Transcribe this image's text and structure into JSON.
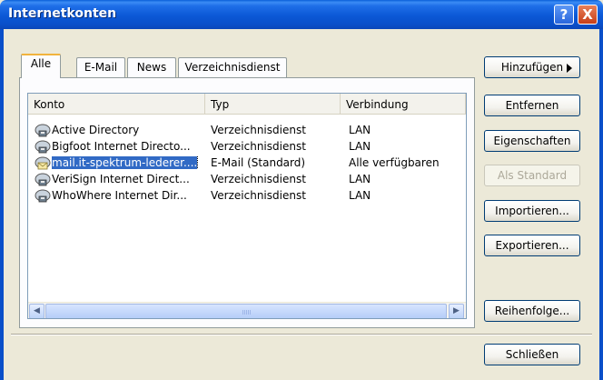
{
  "window": {
    "title": "Internetkonten"
  },
  "titlebar": {
    "help_label": "?",
    "close_label": "X"
  },
  "tabs": [
    {
      "label": "Alle",
      "active": true
    },
    {
      "label": "E-Mail",
      "active": false
    },
    {
      "label": "News",
      "active": false
    },
    {
      "label": "Verzeichnisdienst",
      "active": false
    }
  ],
  "list": {
    "columns": [
      "Konto",
      "Typ",
      "Verbindung"
    ],
    "rows": [
      {
        "konto": "Active Directory",
        "typ": "Verzeichnisdienst",
        "verbindung": "LAN",
        "icon": "directory-service-icon",
        "selected": false
      },
      {
        "konto": "Bigfoot Internet Directo...",
        "typ": "Verzeichnisdienst",
        "verbindung": "LAN",
        "icon": "directory-service-icon",
        "selected": false
      },
      {
        "konto": "mail.it-spektrum-lederer....",
        "typ": "E-Mail (Standard)",
        "verbindung": "Alle verfügbaren",
        "icon": "mail-account-icon",
        "selected": true
      },
      {
        "konto": "VeriSign Internet Direct...",
        "typ": "Verzeichnisdienst",
        "verbindung": "LAN",
        "icon": "directory-service-icon",
        "selected": false
      },
      {
        "konto": "WhoWhere Internet Dir...",
        "typ": "Verzeichnisdienst",
        "verbindung": "LAN",
        "icon": "directory-service-icon",
        "selected": false
      }
    ]
  },
  "buttons": {
    "add": "Hinzufügen",
    "remove": "Entfernen",
    "properties": "Eigenschaften",
    "set_default": "Als Standard",
    "import": "Importieren...",
    "export": "Exportieren...",
    "order": "Reihenfolge...",
    "close": "Schließen"
  },
  "colors": {
    "titlebar": "#0a58d6",
    "selection": "#316ac5",
    "tab_accent": "#f1b33d"
  }
}
